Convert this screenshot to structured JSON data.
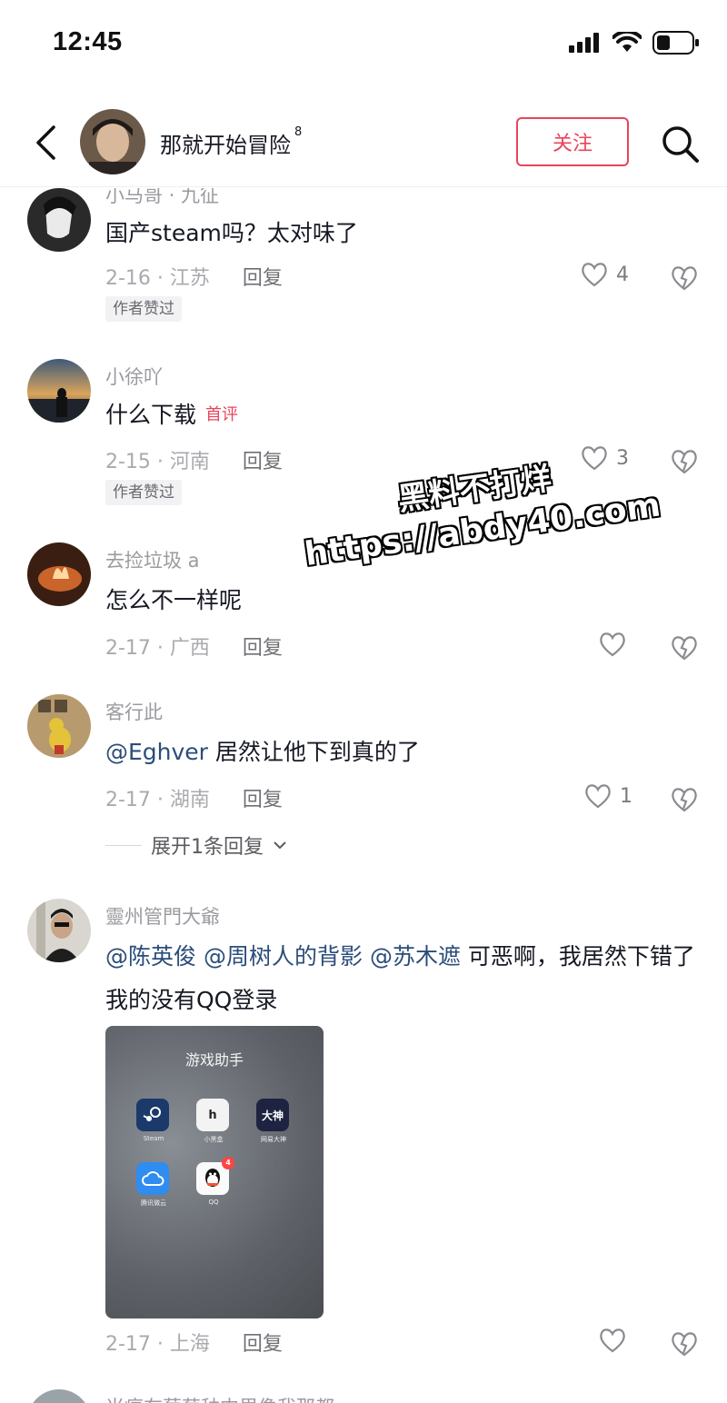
{
  "status_bar": {
    "time": "12:45"
  },
  "header": {
    "title": "那就开始冒险",
    "title_sup": "8",
    "follow_label": "关注"
  },
  "comments": [
    {
      "user": "小马哥 · 九征",
      "text": "国产steam吗？太对味了",
      "date_loc": "2-16 · 江苏",
      "reply": "回复",
      "likes": "4",
      "author_liked": "作者赞过"
    },
    {
      "user": "小徐吖",
      "text": "什么下载",
      "tag": "首评",
      "date_loc": "2-15 · 河南",
      "reply": "回复",
      "likes": "3",
      "author_liked": "作者赞过"
    },
    {
      "user": "去捡垃圾 a",
      "text": "怎么不一样呢",
      "date_loc": "2-17 · 广西",
      "reply": "回复",
      "likes": ""
    },
    {
      "user": "客行此",
      "mention": "@Eghver",
      "text": " 居然让他下到真的了",
      "date_loc": "2-17 · 湖南",
      "reply": "回复",
      "likes": "1",
      "expand": "展开1条回复"
    },
    {
      "user": "靈州管門大爺",
      "mention1": "@陈英俊",
      "mention2": "@周树人的背影",
      "mention3": "@苏木遮",
      "text": " 可恶啊，我居然下错了我的没有QQ登录",
      "date_loc": "2-17 · 上海",
      "reply": "回复",
      "likes": "",
      "attachment": {
        "folder_title": "游戏助手",
        "apps": [
          {
            "label": "Steam",
            "glyph": ""
          },
          {
            "label": "小黑盒",
            "glyph": "h"
          },
          {
            "label": "网易大神",
            "glyph": "大神"
          },
          {
            "label": "腾讯微云",
            "glyph": ""
          },
          {
            "label": "QQ",
            "glyph": "",
            "badge": "4"
          }
        ]
      }
    }
  ],
  "partial_next": "当痛在葡萄种中里像我那都",
  "watermark": {
    "line1": "黑料不打烊",
    "line2": "https://abdy40.com"
  },
  "colors": {
    "accent": "#e9445a",
    "mention": "#2b4d7a",
    "meta": "#a9aaae"
  }
}
